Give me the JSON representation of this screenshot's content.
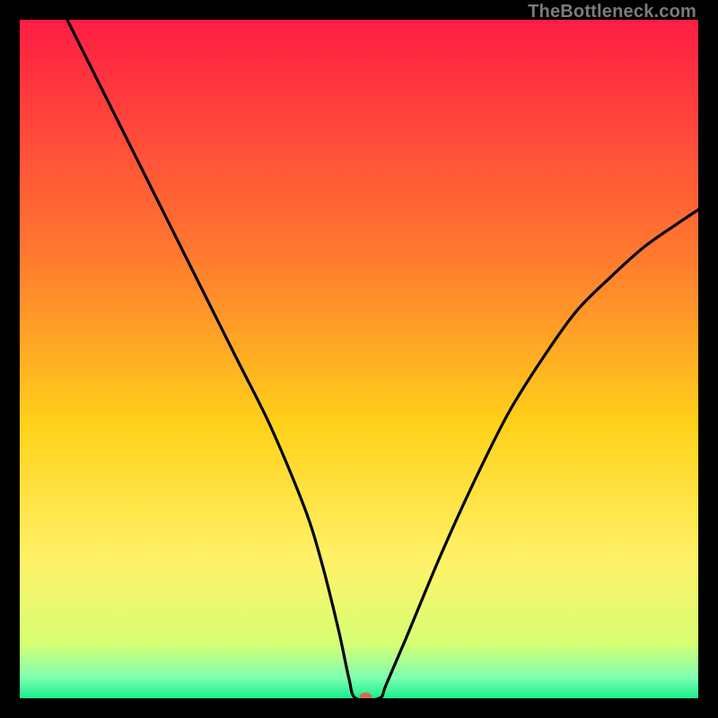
{
  "watermark": "TheBottleneck.com",
  "chart_data": {
    "type": "line",
    "title": "",
    "xlabel": "",
    "ylabel": "",
    "xlim": [
      0,
      100
    ],
    "ylim": [
      0,
      100
    ],
    "grid": false,
    "legend": false,
    "background_gradient_stops": [
      {
        "offset": 0,
        "color": "#ff1d44"
      },
      {
        "offset": 0.35,
        "color": "#ff7a2f"
      },
      {
        "offset": 0.6,
        "color": "#ffd21a"
      },
      {
        "offset": 0.8,
        "color": "#fff26a"
      },
      {
        "offset": 0.92,
        "color": "#d7ff73"
      },
      {
        "offset": 0.97,
        "color": "#7dffb2"
      },
      {
        "offset": 1.0,
        "color": "#18f08c"
      }
    ],
    "series": [
      {
        "name": "bottleneck-curve",
        "type": "line",
        "color": "#000000",
        "x": [
          7,
          12,
          17,
          22,
          27,
          32,
          37,
          42,
          44.5,
          47,
          48.5,
          49.5,
          53,
          54,
          57,
          62,
          67,
          72,
          77,
          82,
          87,
          92,
          97,
          100
        ],
        "y": [
          100,
          90,
          80,
          70,
          60,
          50,
          40,
          28,
          20,
          10,
          3,
          0,
          0,
          2,
          9,
          21,
          32,
          42,
          50,
          57,
          62,
          66.5,
          70,
          72
        ]
      }
    ],
    "marker": {
      "name": "optimal-point",
      "x": 51,
      "y": 0.2,
      "color": "#d46a5a",
      "rx": 7,
      "ry": 5
    }
  }
}
